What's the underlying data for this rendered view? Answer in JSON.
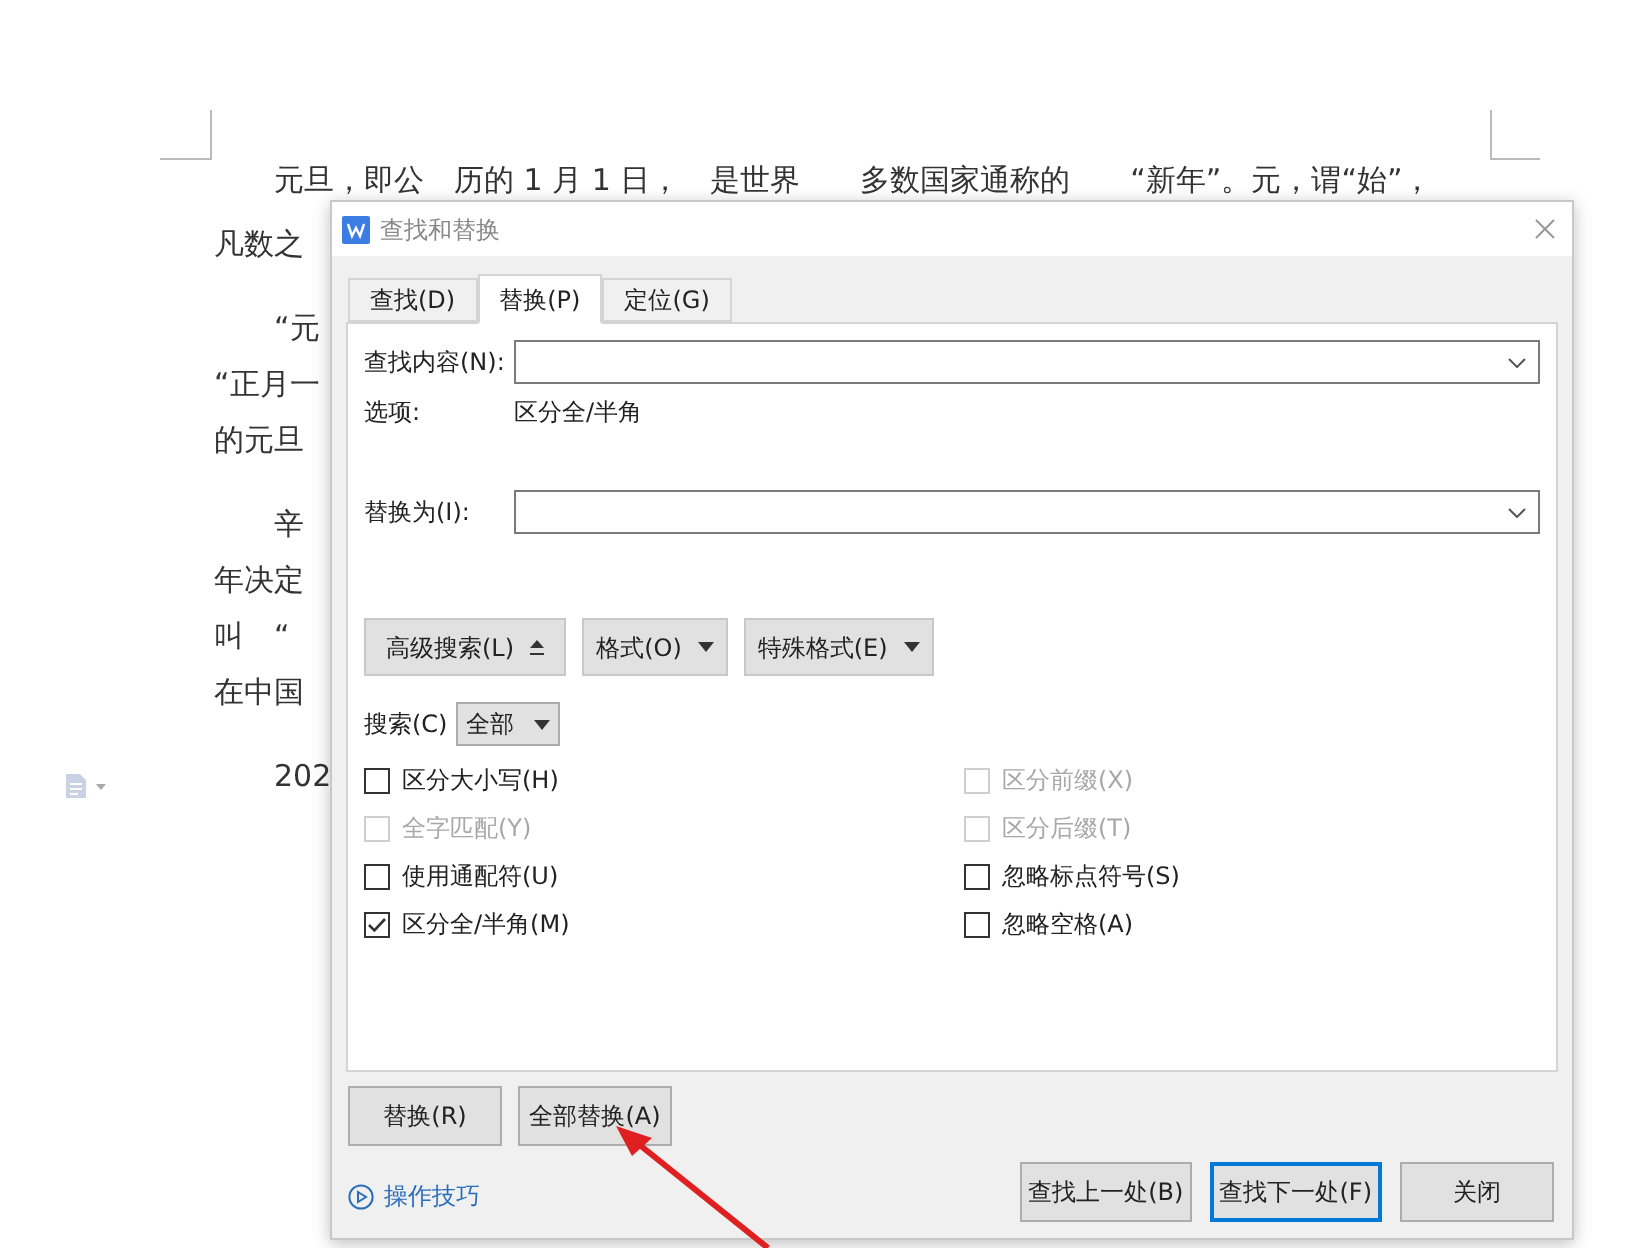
{
  "document": {
    "paragraphs": [
      [
        "元旦，即公　历的 1 月 1 日，　是世界　　多数国家通称的　　“新年”。元，谓“始”，",
        "凡数之"
      ],
      [
        "“元",
        "“正月一",
        "的元旦"
      ],
      [
        "辛",
        "年决定",
        "叫　“",
        "在中国"
      ],
      [
        "202"
      ]
    ]
  },
  "dialog": {
    "title": "查找和替换",
    "tabs": [
      {
        "label": "查找(D)",
        "selected": false
      },
      {
        "label": "替换(P)",
        "selected": true
      },
      {
        "label": "定位(G)",
        "selected": false
      }
    ],
    "find": {
      "label": "查找内容(N):"
    },
    "options": {
      "label": "选项:",
      "value": "区分全/半角"
    },
    "replace": {
      "label": "替换为(I):"
    },
    "tool_buttons": [
      {
        "label": "高级搜索(L)",
        "kind": "toggle"
      },
      {
        "label": "格式(O)",
        "kind": "menu"
      },
      {
        "label": "特殊格式(E)",
        "kind": "menu"
      }
    ],
    "search_scope": {
      "label": "搜索(C)",
      "value": "全部"
    },
    "checkboxes_left": [
      {
        "label": "区分大小写(H)",
        "checked": false,
        "disabled": false
      },
      {
        "label": "全字匹配(Y)",
        "checked": false,
        "disabled": true
      },
      {
        "label": "使用通配符(U)",
        "checked": false,
        "disabled": false
      },
      {
        "label": "区分全/半角(M)",
        "checked": true,
        "disabled": false
      }
    ],
    "checkboxes_right": [
      {
        "label": "区分前缀(X)",
        "checked": false,
        "disabled": true
      },
      {
        "label": "区分后缀(T)",
        "checked": false,
        "disabled": true
      },
      {
        "label": "忽略标点符号(S)",
        "checked": false,
        "disabled": false
      },
      {
        "label": "忽略空格(A)",
        "checked": false,
        "disabled": false
      }
    ],
    "replace_buttons": [
      "替换(R)",
      "全部替换(A)"
    ],
    "tips_link": "操作技巧",
    "footer_buttons": [
      {
        "label": "查找上一处(B)",
        "default": false
      },
      {
        "label": "查找下一处(F)",
        "default": true
      },
      {
        "label": "关闭",
        "default": false
      }
    ]
  }
}
